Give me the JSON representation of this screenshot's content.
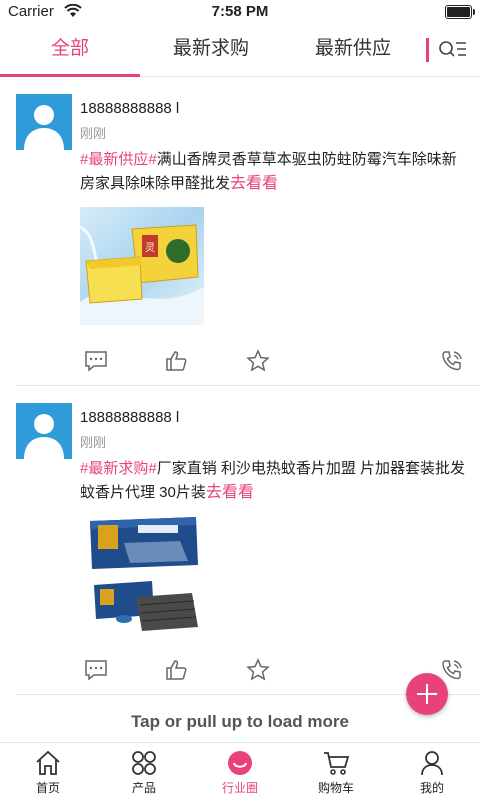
{
  "status_bar": {
    "carrier": "Carrier",
    "time": "7:58 PM"
  },
  "tabs": [
    {
      "label": "全部",
      "active": true
    },
    {
      "label": "最新求购",
      "active": false
    },
    {
      "label": "最新供应",
      "active": false
    }
  ],
  "posts": [
    {
      "name": "18888888888 l",
      "time": "刚刚",
      "tag": "#最新供应#",
      "text": "满山香牌灵香草草本驱虫防蛀防霉汽车除味新房家具除味除甲醛批发",
      "more": "去看看",
      "product_image_text": "灵香草"
    },
    {
      "name": "18888888888 l",
      "time": "刚刚",
      "tag": "#最新求购#",
      "text": "厂家直销 利沙电热蚊香片加盟 片加器套装批发 蚊香片代理 30片装",
      "more": "去看看",
      "product_image_text": "电热蚊香片"
    }
  ],
  "load_more": "Tap or pull up to load more",
  "bottom_nav": [
    {
      "label": "首页",
      "icon": "home-icon",
      "active": false
    },
    {
      "label": "产品",
      "icon": "grid-icon",
      "active": false
    },
    {
      "label": "行业圈",
      "icon": "smile-icon",
      "active": true
    },
    {
      "label": "购物车",
      "icon": "cart-icon",
      "active": false
    },
    {
      "label": "我的",
      "icon": "user-icon",
      "active": false
    }
  ],
  "colors": {
    "accent": "#e8427d",
    "avatar_bg": "#2f9bd8"
  }
}
